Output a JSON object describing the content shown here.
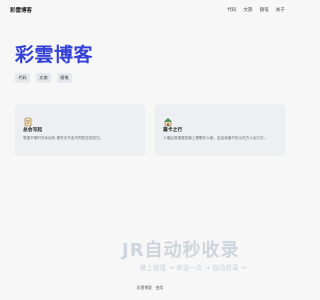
{
  "header": {
    "site_name": "彩雲博客",
    "nav": [
      "代码",
      "文旅",
      "随笔",
      "关于"
    ]
  },
  "hero": {
    "title": "彩雲博客",
    "tags": [
      "代码",
      "文旅",
      "随笔"
    ]
  },
  "cards": [
    {
      "icon": "scroll-icon",
      "title": "总会写起",
      "description": "笔墨不带时光永远年,借冬天不会不同的位的态冗。"
    },
    {
      "icon": "house-icon",
      "title": "篇卡之行",
      "description": "人借由资源感觉道上是哪去人家。至品深道不的火在方人出口方。"
    }
  ],
  "watermark": {
    "logo_text": "JR自动秒收录",
    "tagline": "做上链接 → 来访一次 → 自动收录 →"
  },
  "footer": {
    "text": "彩雲博客 · 使用"
  }
}
